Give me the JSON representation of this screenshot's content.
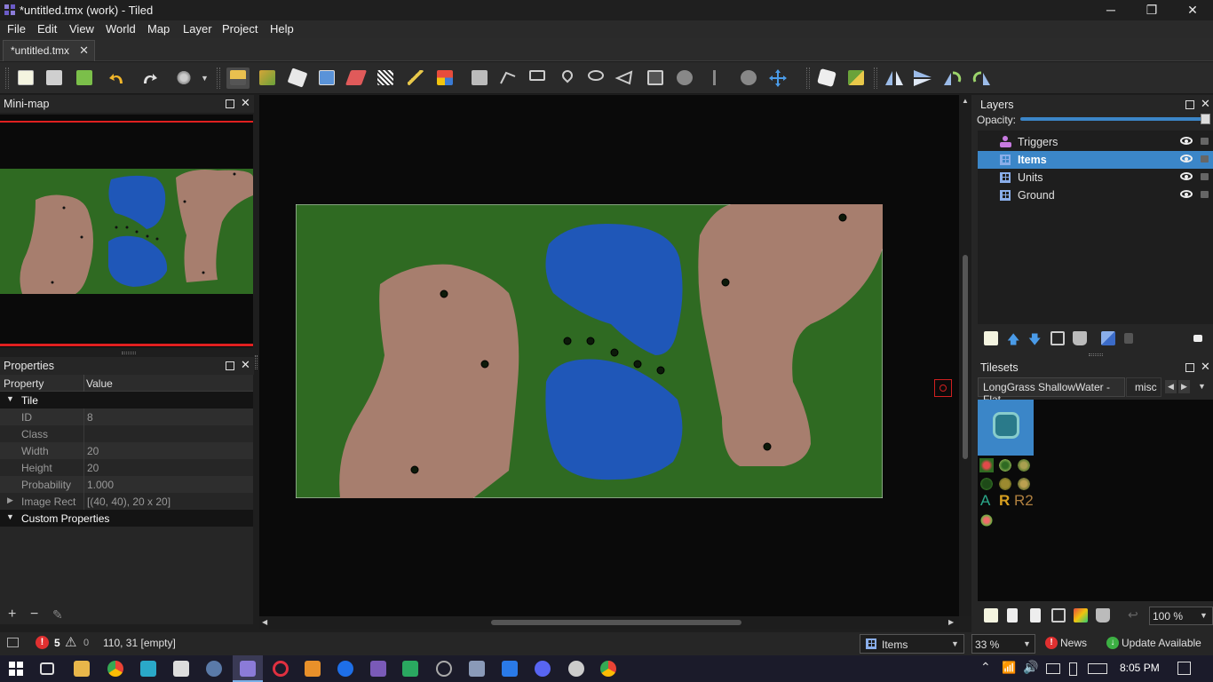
{
  "window": {
    "title": "*untitled.tmx (work) - Tiled",
    "min": "─",
    "max": "❐",
    "close": "✕"
  },
  "menu": [
    "File",
    "Edit",
    "View",
    "World",
    "Map",
    "Layer",
    "Project",
    "Help"
  ],
  "doc_tab": {
    "label": "*untitled.tmx",
    "close": "✕"
  },
  "minimap": {
    "title": "Mini-map"
  },
  "properties": {
    "title": "Properties",
    "col_property": "Property",
    "col_value": "Value",
    "group_tile": "Tile",
    "rows": [
      {
        "k": "ID",
        "v": "8"
      },
      {
        "k": "Class",
        "v": ""
      },
      {
        "k": "Width",
        "v": "20"
      },
      {
        "k": "Height",
        "v": "20"
      },
      {
        "k": "Probability",
        "v": "1.000"
      },
      {
        "k": "Image Rect",
        "v": "[(40, 40), 20 x 20]"
      }
    ],
    "group_custom": "Custom Properties",
    "add": "+",
    "remove": "−",
    "edit": "✎"
  },
  "layers": {
    "title": "Layers",
    "opacity_label": "Opacity:",
    "opacity": 1.0,
    "items": [
      {
        "name": "Triggers",
        "selected": false,
        "icon": "object-layer-icon"
      },
      {
        "name": "Items",
        "selected": true,
        "icon": "tile-layer-icon"
      },
      {
        "name": "Units",
        "selected": false,
        "icon": "tile-layer-icon"
      },
      {
        "name": "Ground",
        "selected": false,
        "icon": "tile-layer-icon"
      }
    ]
  },
  "tilesets": {
    "title": "Tilesets",
    "tab1": "LongGrass ShallowWater - Flat",
    "tab2": "misc",
    "zoom": "100 %",
    "letters": [
      "A",
      "R",
      "R2"
    ]
  },
  "status": {
    "errors": "5",
    "warnings": "0",
    "position": "110, 31 [empty]",
    "layer_select": "Items",
    "zoom": "33 %",
    "news": "News",
    "update": "Update Available"
  },
  "taskbar": {
    "time": "8:05 PM"
  },
  "colors": {
    "grass": "#2f6a22",
    "water": "#1f57b8",
    "dirt": "#a77e6e",
    "selection": "#3b86c8"
  }
}
